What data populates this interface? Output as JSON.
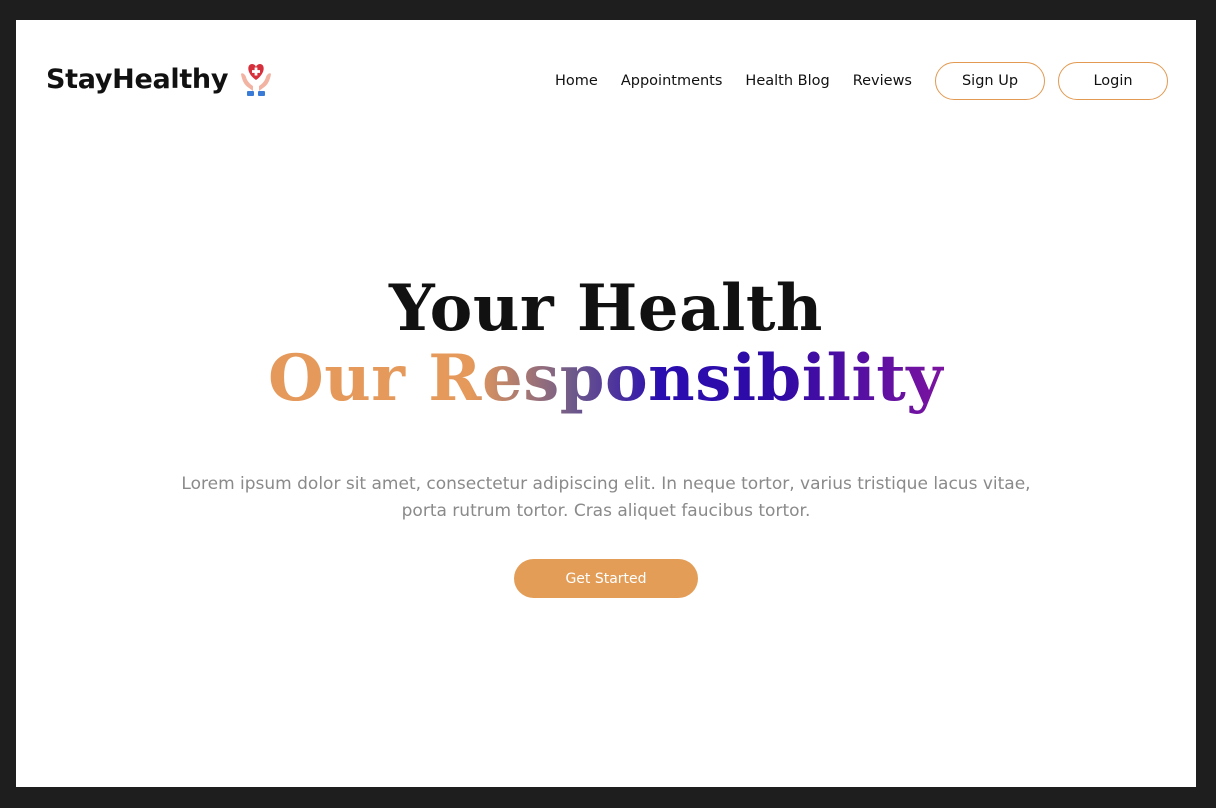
{
  "brand": {
    "name": "StayHealthy",
    "icon": "heart-hands-icon"
  },
  "nav": {
    "links": [
      "Home",
      "Appointments",
      "Health Blog",
      "Reviews"
    ],
    "signup_label": "Sign Up",
    "login_label": "Login"
  },
  "hero": {
    "title_line1": "Your Health",
    "title_line2": "Our Responsibility",
    "description": "Lorem ipsum dolor sit amet, consectetur adipiscing elit. In neque tortor, varius tristique lacus vitae, porta rutrum tortor. Cras aliquet faucibus tortor.",
    "cta_label": "Get Started"
  },
  "colors": {
    "accent": "#e39d57",
    "gradient_start": "#e5995a",
    "gradient_mid": "#2a0db0",
    "gradient_end": "#7c14a0",
    "background": "#ffffff",
    "frame": "#1e1e1e"
  }
}
